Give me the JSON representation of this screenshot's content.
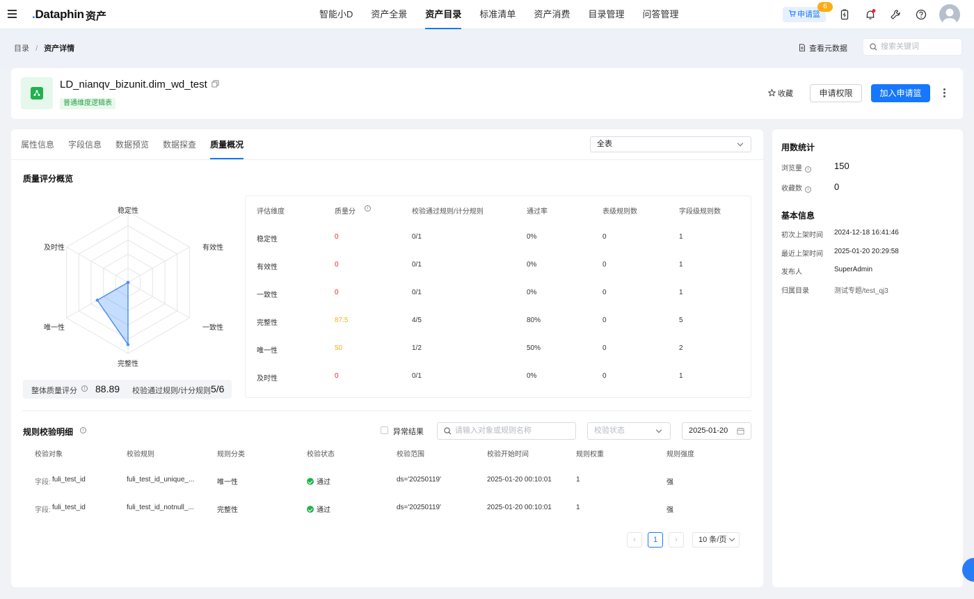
{
  "nav": {
    "logo": "Dataphin",
    "app_name": "资产",
    "menu": [
      "智能小D",
      "资产全景",
      "资产目录",
      "标准清单",
      "资产消费",
      "目录管理",
      "问答管理"
    ],
    "cart_label": "申请篮",
    "cart_count": "6"
  },
  "breadcrumb": {
    "root": "目录",
    "sep": "/",
    "current": "资产详情"
  },
  "view_metadata": "查看元数据",
  "search_placeholder": "搜索关键词",
  "asset": {
    "name": "LD_nianqv_bizunit.dim_wd_test",
    "tag": "普通维度逻辑表",
    "fav_label": "收藏",
    "request_label": "申请权限",
    "add_label": "加入申请篮"
  },
  "tabs": [
    "属性信息",
    "字段信息",
    "数据预览",
    "数据探查",
    "质量概况"
  ],
  "scope_select": "全表",
  "quality": {
    "title": "质量评分概览",
    "radar_labels": [
      "稳定性",
      "有效性",
      "一致性",
      "完整性",
      "唯一性",
      "及时性"
    ],
    "radar_values": [
      0,
      0,
      0,
      87.5,
      50,
      0
    ],
    "overall_label": "整体质量评分",
    "overall_score": "88.89",
    "pass_label": "校验通过规则/计分规则",
    "pass_value": "5/6"
  },
  "dim_table": {
    "headers": [
      "评估维度",
      "质量分",
      "校验通过规则/计分规则",
      "通过率",
      "表级规则数",
      "字段级规则数"
    ],
    "rows": [
      {
        "dim": "稳定性",
        "score": "0",
        "pass": "0/1",
        "rate": "0%",
        "table_rules": "0",
        "field_rules": "1",
        "color": "#f5222d"
      },
      {
        "dim": "有效性",
        "score": "0",
        "pass": "0/1",
        "rate": "0%",
        "table_rules": "0",
        "field_rules": "1",
        "color": "#f5222d"
      },
      {
        "dim": "一致性",
        "score": "0",
        "pass": "0/1",
        "rate": "0%",
        "table_rules": "0",
        "field_rules": "1",
        "color": "#f5222d"
      },
      {
        "dim": "完整性",
        "score": "87.5",
        "pass": "4/5",
        "rate": "80%",
        "table_rules": "0",
        "field_rules": "5",
        "color": "#faad14"
      },
      {
        "dim": "唯一性",
        "score": "50",
        "pass": "1/2",
        "rate": "50%",
        "table_rules": "0",
        "field_rules": "2",
        "color": "#faad14"
      },
      {
        "dim": "及时性",
        "score": "0",
        "pass": "0/1",
        "rate": "0%",
        "table_rules": "0",
        "field_rules": "1",
        "color": "#f5222d"
      }
    ]
  },
  "rules": {
    "title": "规则校验明细",
    "anomaly_label": "异常结果",
    "search_placeholder": "请输入对象或规则名称",
    "status_placeholder": "校验状态",
    "date": "2025-01-20",
    "headers": [
      "校验对象",
      "校验规则",
      "规则分类",
      "校验状态",
      "校验范围",
      "校验开始时间",
      "规则权重",
      "规则强度"
    ],
    "rows": [
      {
        "obj_prefix": "字段:",
        "obj": "fuli_test_id",
        "rule": "fuli_test_id_unique_...",
        "cat": "唯一性",
        "status": "通过",
        "range": "ds='20250119'",
        "start": "2025-01-20 00:10:01",
        "weight": "1",
        "strength": "强"
      },
      {
        "obj_prefix": "字段:",
        "obj": "fuli_test_id",
        "rule": "fuli_test_id_notnull_...",
        "cat": "完整性",
        "status": "通过",
        "range": "ds='20250119'",
        "start": "2025-01-20 00:10:01",
        "weight": "1",
        "strength": "强"
      }
    ],
    "page": "1",
    "page_size": "10 条/页"
  },
  "side": {
    "usage_title": "用数统计",
    "views_label": "浏览量",
    "views": "150",
    "favs_label": "收藏数",
    "favs": "0",
    "basic_title": "基本信息",
    "first_label": "初次上架时间",
    "first": "2024-12-18 16:41:46",
    "last_label": "最近上架时间",
    "last": "2025-01-20 20:29:58",
    "publisher_label": "发布人",
    "publisher": "SuperAdmin",
    "dir_label": "归属目录",
    "dir": "测试专题/test_qj3"
  }
}
